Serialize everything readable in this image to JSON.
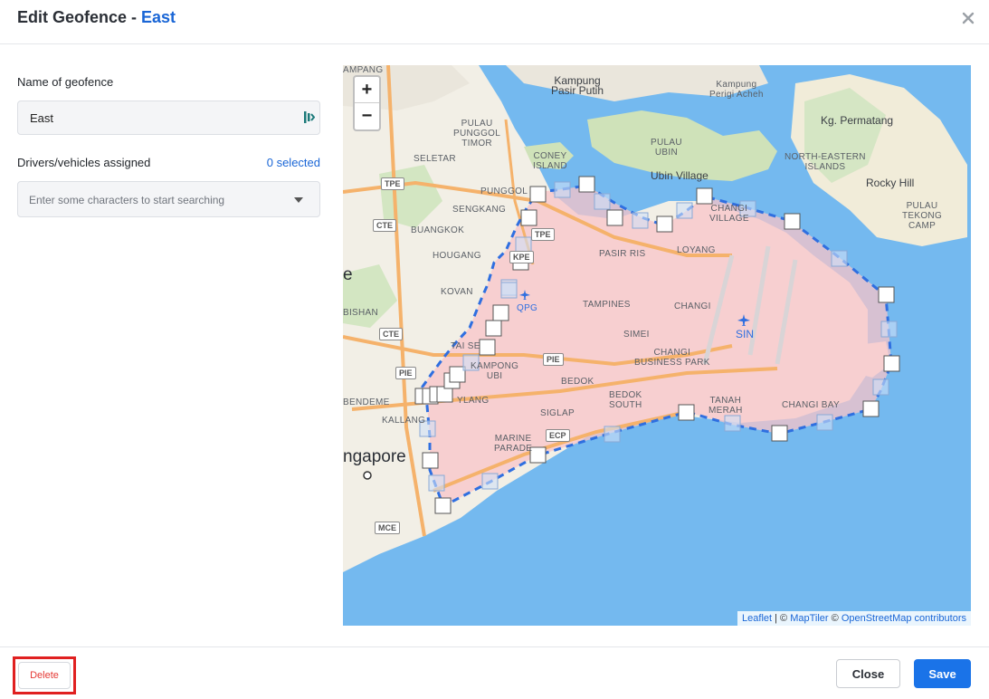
{
  "header": {
    "title_prefix": "Edit Geofence - ",
    "title_name": "East",
    "close_icon": "close-icon"
  },
  "form": {
    "name_label": "Name of geofence",
    "name_value": "East",
    "drivers_label": "Drivers/vehicles assigned",
    "selected_text": "0 selected",
    "search_placeholder": "Enter some characters to start searching"
  },
  "map": {
    "zoom_in": "+",
    "zoom_out": "−",
    "attribution": {
      "leaflet": "Leaflet",
      "separator": " | © ",
      "maptiler": "MapTiler",
      "mid": " © ",
      "osm": "OpenStreetMap contributors"
    },
    "labels": {
      "kampung_pasir_putih": "Kampung\nPasir Putih",
      "kampung_perigi_acheh": "Kampung\nPerigi Acheh",
      "kg_permatang": "Kg. Permatang",
      "pulau_ubin": "PULAU\nUBIN",
      "ubin_village": "Ubin Village",
      "north_eastern_islands": "NORTH-EASTERN\nISLANDS",
      "rocky_hill": "Rocky Hill",
      "pulau_tekong_camp": "PULAU\nTEKONG\nCAMP",
      "pulau_punggol_timor": "PULAU\nPUNGGOL\nTIMOR",
      "coney_island": "CONEY\nISLAND",
      "seletar": "SELETAR",
      "punggol": "PUNGGOL",
      "sengkang": "SENGKANG",
      "buangkok": "BUANGKOK",
      "hougang": "HOUGANG",
      "kovan": "KOVAN",
      "changi_village": "CHANGI\nVILLAGE",
      "pasir_ris": "PASIR RIS",
      "loyang": "LOYANG",
      "tampines": "TAMPINES",
      "changi": "CHANGI",
      "simei": "SIMEI",
      "changi_business_park": "CHANGI\nBUSINESS PARK",
      "bedok": "BEDOK",
      "bedok_south": "BEDOK\nSOUTH",
      "tanah_merah": "TANAH\nMERAH",
      "changi_bay": "CHANGI BAY",
      "siglap": "SIGLAP",
      "marine_parade": "MARINE\nPARADE",
      "bishan": "BISHAN",
      "tai_seng": "TAI SE",
      "kampong_ubi": "KAMPONG\nUBI",
      "geylang": "YLANG",
      "bendemeer": "BENDEME",
      "kallang": "KALLANG",
      "singapore": "ngapore",
      "e_edge": "e",
      "ampang": "AMPANG",
      "qpg": "QPG",
      "sin": "SIN"
    },
    "roads": [
      "TPE",
      "CTE",
      "TPE",
      "KPE",
      "CTE",
      "PIE",
      "PIE",
      "ECP",
      "MCE"
    ]
  },
  "footer": {
    "delete_label": "Delete",
    "close_label": "Close",
    "save_label": "Save"
  },
  "colors": {
    "accent": "#1a66d6",
    "primary_button": "#1a73e8",
    "delete_text": "#e53935",
    "highlight": "#e02020",
    "water": "#74b9ef",
    "land": "#f2efe6",
    "geofence_fill": "#f8c4c8",
    "geofence_stroke": "#2f6fe0"
  }
}
